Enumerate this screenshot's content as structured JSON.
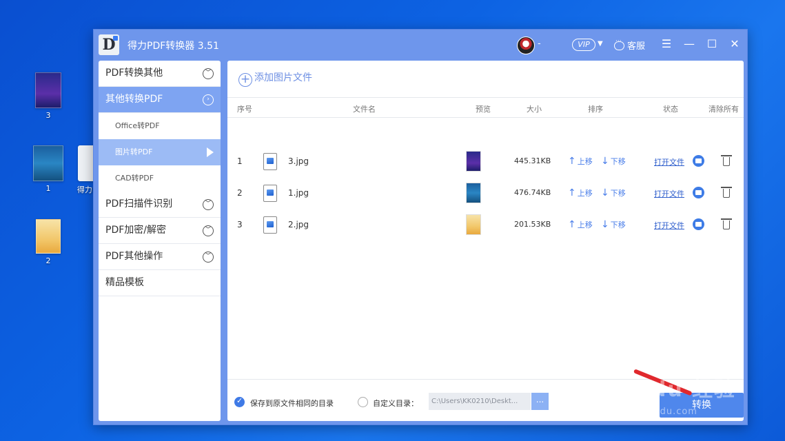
{
  "desktop": {
    "icons": [
      {
        "label": "3"
      },
      {
        "label": "1"
      },
      {
        "label": "得力F"
      },
      {
        "label": "2"
      }
    ]
  },
  "window": {
    "title": "得力PDF转换器 3.51",
    "logo_letter": "D",
    "user_name": "-",
    "vip": "VIP",
    "service": "客服",
    "controls": {
      "menu": "☰",
      "minimize": "—",
      "maximize": "☐",
      "close": "✕"
    }
  },
  "sidebar": {
    "cat_pdf_to_other": "PDF转换其他",
    "cat_other_to_pdf": "其他转换PDF",
    "sub_office": "Office转PDF",
    "sub_image": "图片转PDF",
    "sub_cad": "CAD转PDF",
    "cat_scan": "PDF扫描件识别",
    "cat_encrypt": "PDF加密/解密",
    "cat_ops": "PDF其他操作",
    "cat_templates": "精品模板"
  },
  "main": {
    "add_label": "添加图片文件",
    "columns": {
      "index": "序号",
      "filename": "文件名",
      "preview": "预览",
      "size": "大小",
      "sort": "排序",
      "status": "状态",
      "clear": "清除所有"
    },
    "rows": [
      {
        "index": "1",
        "name": "3.jpg",
        "size": "445.31KB",
        "up": "上移",
        "down": "下移",
        "open": "打开文件"
      },
      {
        "index": "2",
        "name": "1.jpg",
        "size": "476.74KB",
        "up": "上移",
        "down": "下移",
        "open": "打开文件"
      },
      {
        "index": "3",
        "name": "2.jpg",
        "size": "201.53KB",
        "up": "上移",
        "down": "下移",
        "open": "打开文件"
      }
    ],
    "save_same_dir": "保存到原文件相同的目录",
    "custom_dir": "自定义目录：",
    "path_value": "C:\\Users\\KK0210\\Deskt...",
    "browse": "...",
    "convert": "转换"
  },
  "watermark": {
    "text": "Bai du 经验",
    "url": "jingyan.baidu.com"
  }
}
